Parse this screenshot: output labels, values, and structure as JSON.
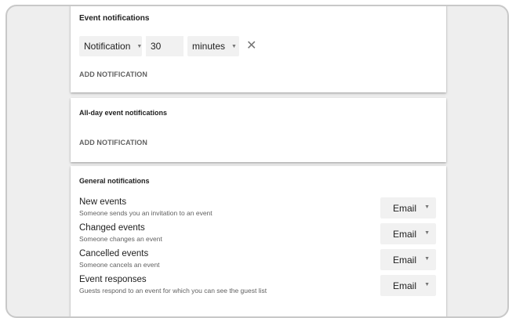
{
  "event_notifications": {
    "title": "Event notifications",
    "type_select": "Notification",
    "amount": "30",
    "unit_select": "minutes",
    "add_label": "ADD NOTIFICATION"
  },
  "allday_notifications": {
    "title": "All-day event notifications",
    "add_label": "ADD NOTIFICATION"
  },
  "general_notifications": {
    "title": "General notifications",
    "rows": [
      {
        "title": "New events",
        "subtitle": "Someone sends you an invitation to an event",
        "method": "Email"
      },
      {
        "title": "Changed events",
        "subtitle": "Someone changes an event",
        "method": "Email"
      },
      {
        "title": "Cancelled events",
        "subtitle": "Someone cancels an event",
        "method": "Email"
      },
      {
        "title": "Event responses",
        "subtitle": "Guests respond to an event for which you can see the guest list",
        "method": "Email"
      }
    ]
  },
  "icons": {
    "dropdown": "caret-down-icon",
    "remove": "close-icon"
  }
}
